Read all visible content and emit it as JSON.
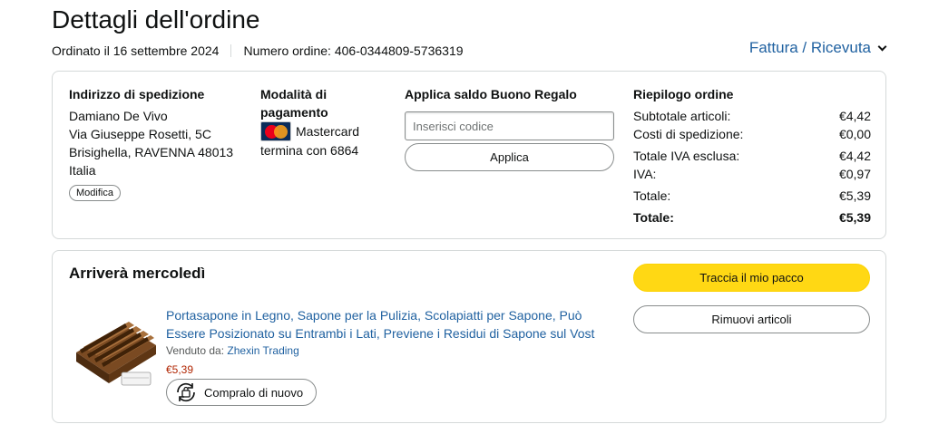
{
  "header": {
    "title": "Dettagli dell'ordine",
    "ordered_on": "Ordinato il 16 settembre 2024",
    "order_number": "Numero ordine: 406-0344809-5736319",
    "invoice_link": "Fattura / Ricevuta"
  },
  "shipping": {
    "title": "Indirizzo di spedizione",
    "lines": [
      "Damiano De Vivo",
      "Via Giuseppe Rosetti, 5C",
      "Brisighella, RAVENNA 48013",
      "Italia"
    ],
    "edit_label": "Modifica"
  },
  "payment": {
    "title": "Modalità di pagamento",
    "card_icon": "mastercard-icon",
    "card_name": "Mastercard",
    "card_ending": "termina con 6864"
  },
  "gift_card": {
    "title": "Applica saldo Buono Regalo",
    "placeholder": "Inserisci codice",
    "apply_label": "Applica"
  },
  "summary": {
    "title": "Riepilogo ordine",
    "rows": [
      {
        "label": "Subtotale articoli:",
        "value": "€4,42"
      },
      {
        "label": "Costi di spedizione:",
        "value": "€0,00"
      },
      {
        "label": "Totale IVA esclusa:",
        "value": "€4,42"
      },
      {
        "label": "IVA:",
        "value": "€0,97"
      },
      {
        "label": "Totale:",
        "value": "€5,39"
      },
      {
        "label": "Totale:",
        "value": "€5,39"
      }
    ]
  },
  "shipment": {
    "arrival": "Arriverà mercoledì",
    "track_label": "Traccia il mio pacco",
    "remove_label": "Rimuovi articoli",
    "product": {
      "title": "Portasapone in Legno, Sapone per la Pulizia, Scolapiatti per Sapone, Può Essere Posizionato su Entrambi i Lati, Previene i Residui di Sapone sul Vost",
      "sold_by_label": "Venduto da:",
      "seller": "Zhexin Trading",
      "price": "€5,39",
      "buy_again_label": "Compralo di nuovo",
      "buy_again_icon": "buy-again-icon"
    }
  },
  "colors": {
    "link": "#2162a1",
    "price": "#b12704",
    "primary_button": "#ffd814",
    "border": "#d5d9d9"
  }
}
